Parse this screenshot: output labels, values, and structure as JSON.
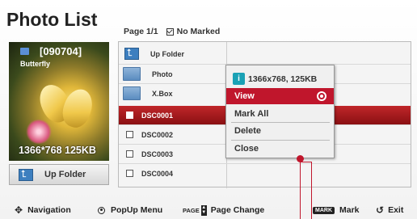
{
  "header": {
    "title": "Photo List",
    "page": "Page 1/1",
    "marked": "No Marked"
  },
  "preview": {
    "code": "[090704]",
    "name": "Butterfly",
    "resolution": "1366*768  125KB"
  },
  "up_button": {
    "label": "Up Folder"
  },
  "list": {
    "folders": [
      "Up Folder",
      "Photo",
      "X.Box"
    ],
    "files": [
      "DSC0001",
      "DSC0002",
      "DSC0003",
      "DSC0004"
    ],
    "selected": "DSC0001"
  },
  "popup": {
    "info": "1366x768, 125KB",
    "items": [
      "View",
      "Mark All",
      "Delete",
      "Close"
    ],
    "active": "View"
  },
  "footer": {
    "navigation": "Navigation",
    "popup_menu": "PopUp Menu",
    "page_change": "Page Change",
    "mark": "Mark",
    "exit": "Exit",
    "page_key": "PAGE",
    "mark_key": "MARK"
  },
  "colors": {
    "accent": "#c0162c",
    "info": "#1aa1b5",
    "folder": "#3d7fbf"
  },
  "icons": [
    "navigation-icon",
    "ok-icon",
    "page-icon",
    "mark-icon",
    "exit-icon",
    "info-icon",
    "up-folder-icon",
    "folder-icon",
    "checkbox-icon",
    "radio-icon"
  ]
}
